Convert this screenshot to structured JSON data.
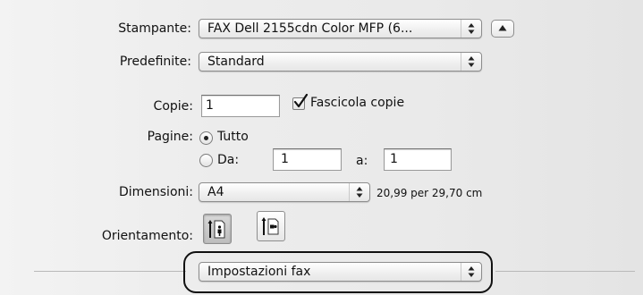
{
  "printer": {
    "label": "Stampante:",
    "value": "FAX Dell 2155cdn Color MFP (6..."
  },
  "presets": {
    "label": "Predefinite:",
    "value": "Standard"
  },
  "copies": {
    "label": "Copie:",
    "value": "1",
    "collate_label": "Fascicola copie",
    "collate_checked": true
  },
  "pages": {
    "label": "Pagine:",
    "all_label": "Tutto",
    "from_label": "Da:",
    "from_value": "1",
    "to_label": "a:",
    "to_value": "1",
    "selected": "all"
  },
  "paper_size": {
    "label": "Dimensioni:",
    "value": "A4",
    "dimensions_text": "20,99 per 29,70 cm"
  },
  "orientation": {
    "label": "Orientamento:",
    "selected": "portrait"
  },
  "section": {
    "value": "Impostazioni fax"
  },
  "icons": {
    "updown": "updown-arrows-icon",
    "disclosure": "disclosure-triangle-icon",
    "portrait": "portrait-orientation-icon",
    "landscape": "landscape-orientation-icon",
    "check": "checkmark-icon"
  }
}
